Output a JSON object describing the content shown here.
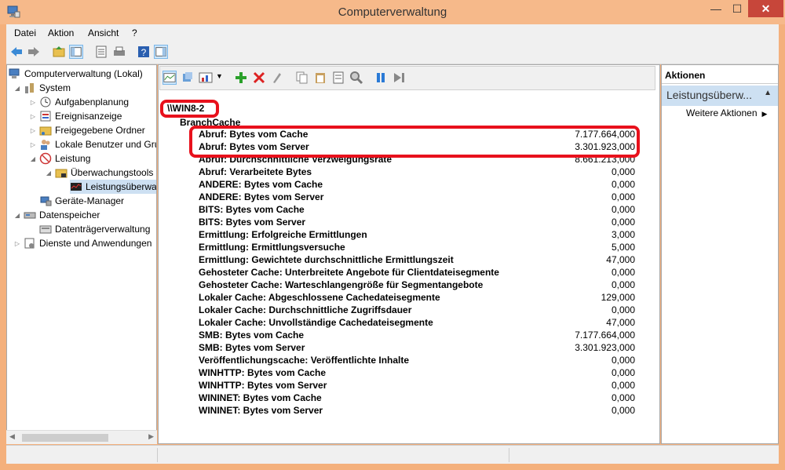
{
  "window": {
    "title": "Computerverwaltung",
    "min": "—",
    "max": "☐",
    "close": "✕"
  },
  "menu": [
    "Datei",
    "Aktion",
    "Ansicht",
    "?"
  ],
  "tree": [
    {
      "label": "Computerverwaltung (Lokal)",
      "icon": "computer-icon"
    },
    {
      "label": "System",
      "icon": "tools-icon"
    },
    {
      "label": "Aufgabenplanung",
      "icon": "clock-icon"
    },
    {
      "label": "Ereignisanzeige",
      "icon": "event-viewer-icon"
    },
    {
      "label": "Freigegebene Ordner",
      "icon": "shared-folder-icon"
    },
    {
      "label": "Lokale Benutzer und Gruppen",
      "icon": "users-icon"
    },
    {
      "label": "Leistung",
      "icon": "performance-icon"
    },
    {
      "label": "Überwachungstools",
      "icon": "folder-icon"
    },
    {
      "label": "Leistungsüberwachung",
      "icon": "monitor-icon"
    },
    {
      "label": "Geräte-Manager",
      "icon": "device-manager-icon"
    },
    {
      "label": "Datenspeicher",
      "icon": "storage-icon"
    },
    {
      "label": "Datenträgerverwaltung",
      "icon": "disk-icon"
    },
    {
      "label": "Dienste und Anwendungen",
      "icon": "services-icon"
    }
  ],
  "report": {
    "host": "\\\\WIN8-2",
    "category": "BranchCache",
    "rows": [
      {
        "name": "Abruf: Bytes vom Cache",
        "value": "7.177.664,000"
      },
      {
        "name": "Abruf: Bytes vom Server",
        "value": "3.301.923,000"
      },
      {
        "name": "Abruf: Durchschnittliche Verzweigungsrate",
        "value": "8.661.213,000"
      },
      {
        "name": "Abruf: Verarbeitete Bytes",
        "value": "0,000"
      },
      {
        "name": "ANDERE: Bytes vom Cache",
        "value": "0,000"
      },
      {
        "name": "ANDERE: Bytes vom Server",
        "value": "0,000"
      },
      {
        "name": "BITS: Bytes vom Cache",
        "value": "0,000"
      },
      {
        "name": "BITS: Bytes vom Server",
        "value": "0,000"
      },
      {
        "name": "Ermittlung: Erfolgreiche Ermittlungen",
        "value": "3,000"
      },
      {
        "name": "Ermittlung: Ermittlungsversuche",
        "value": "5,000"
      },
      {
        "name": "Ermittlung: Gewichtete durchschnittliche Ermittlungszeit",
        "value": "47,000"
      },
      {
        "name": "Gehosteter Cache: Unterbreitete Angebote für Clientdateisegmente",
        "value": "0,000"
      },
      {
        "name": "Gehosteter Cache: Warteschlangengröße für Segmentangebote",
        "value": "0,000"
      },
      {
        "name": "Lokaler Cache: Abgeschlossene Cachedateisegmente",
        "value": "129,000"
      },
      {
        "name": "Lokaler Cache: Durchschnittliche Zugriffsdauer",
        "value": "0,000"
      },
      {
        "name": "Lokaler Cache: Unvollständige Cachedateisegmente",
        "value": "47,000"
      },
      {
        "name": "SMB: Bytes vom Cache",
        "value": "7.177.664,000"
      },
      {
        "name": "SMB: Bytes vom Server",
        "value": "3.301.923,000"
      },
      {
        "name": "Veröffentlichungscache: Veröffentlichte Inhalte",
        "value": "0,000"
      },
      {
        "name": "WINHTTP: Bytes vom Cache",
        "value": "0,000"
      },
      {
        "name": "WINHTTP: Bytes vom Server",
        "value": "0,000"
      },
      {
        "name": "WININET: Bytes vom Cache",
        "value": "0,000"
      },
      {
        "name": "WININET: Bytes vom Server",
        "value": "0,000"
      }
    ]
  },
  "actions": {
    "header": "Aktionen",
    "selected": "Leistungsüberw...",
    "more": "Weitere Aktionen"
  },
  "colors": {
    "highlight": "#e8111c",
    "titlebar": "#f6b98a",
    "selection": "#cde0f2"
  }
}
